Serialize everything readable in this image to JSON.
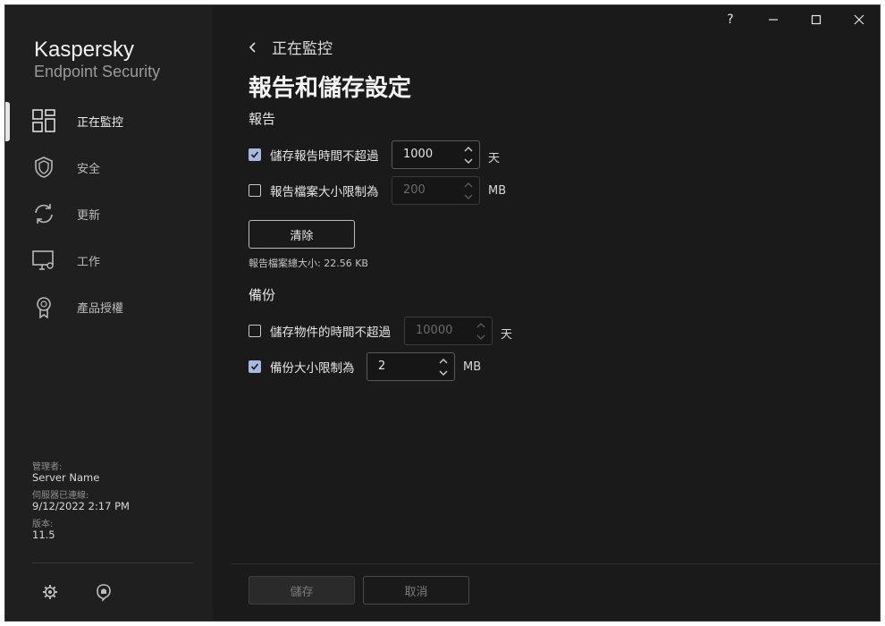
{
  "app": {
    "brand_line1": "Kaspersky",
    "brand_line2": "Endpoint Security"
  },
  "titlebar": {
    "help_glyph": "?",
    "minimize_glyph": "—",
    "maximize_glyph": "☐",
    "close_glyph": "✕"
  },
  "sidebar": {
    "items": [
      {
        "label": "正在監控",
        "icon": "dashboard-icon",
        "active": true
      },
      {
        "label": "安全",
        "icon": "shield-icon",
        "active": false
      },
      {
        "label": "更新",
        "icon": "refresh-icon",
        "active": false
      },
      {
        "label": "工作",
        "icon": "monitor-gear-icon",
        "active": false
      },
      {
        "label": "產品授權",
        "icon": "award-icon",
        "active": false
      }
    ],
    "meta": {
      "admin_label": "管理者:",
      "admin_value": "Server Name",
      "connected_label": "伺服器已連線:",
      "connected_value": "9/12/2022 2:17 PM",
      "version_label": "版本:",
      "version_value": "11.5"
    }
  },
  "main": {
    "breadcrumb": "正在監控",
    "title": "報告和儲存設定",
    "reports": {
      "section_title": "報告",
      "store_time": {
        "label": "儲存報告時間不超過",
        "checked": true,
        "value": "1000",
        "unit": "天"
      },
      "size_limit": {
        "label": "報告檔案大小限制為",
        "checked": false,
        "value": "200",
        "unit": "MB"
      },
      "clear_button": "清除",
      "total_size": "報告檔案總大小: 22.56 KB"
    },
    "backup": {
      "section_title": "備份",
      "store_time": {
        "label": "儲存物件的時間不超過",
        "checked": false,
        "value": "10000",
        "unit": "天"
      },
      "size_limit": {
        "label": "備份大小限制為",
        "checked": true,
        "value": "2",
        "unit": "MB"
      }
    },
    "footer": {
      "save_button": "儲存",
      "cancel_button": "取消"
    }
  },
  "colors": {
    "background": "#1a1a1a",
    "sidebar": "#1f1f1f",
    "checkbox_checked": "#a8b8e0"
  }
}
